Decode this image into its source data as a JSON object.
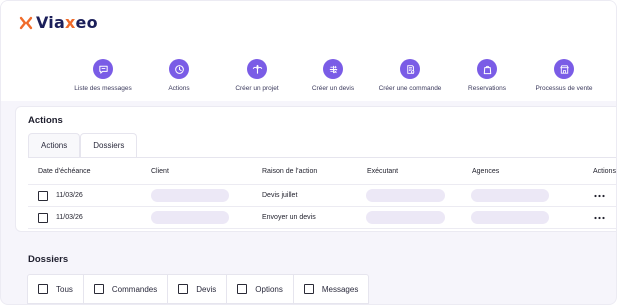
{
  "app": {
    "brand_prefix": "Via",
    "brand_x": "x",
    "brand_suffix": "eo",
    "accent_color": "#7a5ce6",
    "brand_orange": "#f06b2a",
    "brand_navy": "#1b1f5a"
  },
  "shortcuts": [
    {
      "label": "Liste des messages",
      "icon": "message-icon"
    },
    {
      "label": "Actions",
      "icon": "clock-icon"
    },
    {
      "label": "Créer un projet",
      "icon": "palm-tree-icon"
    },
    {
      "label": "Créer un devis",
      "icon": "calculator-icon"
    },
    {
      "label": "Créer une commande",
      "icon": "order-document-icon"
    },
    {
      "label": "Reservations",
      "icon": "bag-icon"
    },
    {
      "label": "Processus de vente",
      "icon": "storefront-icon"
    }
  ],
  "actions_card": {
    "title": "Actions",
    "tabs": [
      {
        "label": "Actions",
        "active": false
      },
      {
        "label": "Dossiers",
        "active": true
      }
    ],
    "columns": [
      "Date d’échéance",
      "Client",
      "Raison de l’action",
      "Exécutant",
      "Agences",
      "Actions"
    ],
    "rows": [
      {
        "date": "11/03/26",
        "reason": "Devis juillet"
      },
      {
        "date": "11/03/26",
        "reason": "Envoyer un devis"
      }
    ],
    "row_menu_icon": "more-horizontal-icon"
  },
  "dossiers": {
    "title": "Dossiers",
    "filters": [
      "Tous",
      "Commandes",
      "Devis",
      "Options",
      "Messages"
    ]
  }
}
